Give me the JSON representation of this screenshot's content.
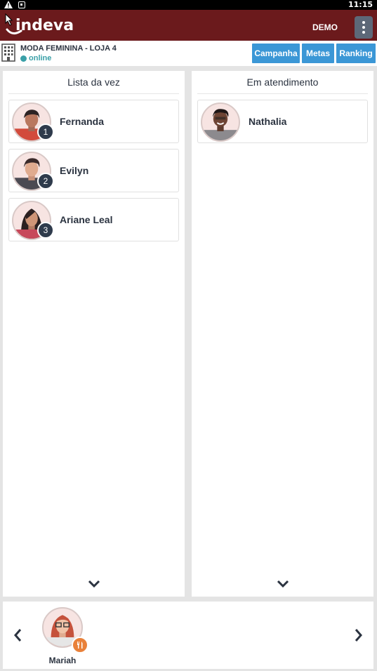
{
  "status_bar": {
    "time": "11:15",
    "icons": [
      "warning-icon",
      "notification-box-icon"
    ]
  },
  "header": {
    "logo": "indeva",
    "user": "DEMO",
    "menu_icon": "kebab-menu-icon",
    "color": "#6b1a1c"
  },
  "store": {
    "name": "MODA FEMININA - LOJA 4",
    "status": "online",
    "status_color": "#3aa0a8"
  },
  "actions": [
    {
      "label": "Campanha"
    },
    {
      "label": "Metas"
    },
    {
      "label": "Ranking"
    }
  ],
  "queue": {
    "title": "Lista da vez",
    "items": [
      {
        "name": "Fernanda",
        "position": "1"
      },
      {
        "name": "Evilyn",
        "position": "2"
      },
      {
        "name": "Ariane Leal",
        "position": "3"
      }
    ]
  },
  "serving": {
    "title": "Em atendimento",
    "items": [
      {
        "name": "Nathalia"
      }
    ]
  },
  "break": {
    "items": [
      {
        "name": "Mariah",
        "status_icon": "cutlery-icon"
      }
    ]
  },
  "colors": {
    "accent": "#3b97d6",
    "badge": "#2f3b4c",
    "break_badge": "#e9813a"
  }
}
